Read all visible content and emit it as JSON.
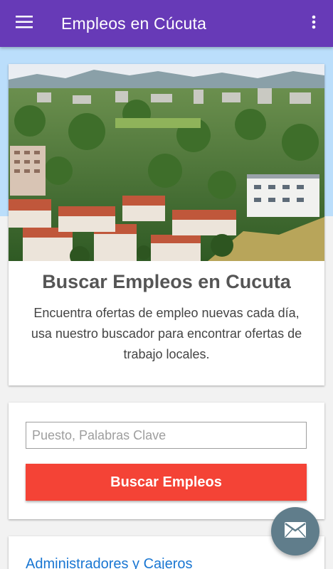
{
  "app_bar": {
    "title": "Empleos en Cúcuta",
    "background": "#673ab7",
    "menu_icon": "hamburger-menu-icon",
    "overflow_icon": "more-vertical-icon"
  },
  "hero": {
    "image_alt": "city-panorama",
    "heading": "Buscar Empleos en Cucuta",
    "text": "Encuentra ofertas de empleo nuevas cada día, usa nuestro buscador para encontrar ofertas de trabajo locales."
  },
  "search": {
    "placeholder": "Puesto, Palabras Clave",
    "value": "",
    "button_label": "Buscar Empleos",
    "button_color": "#f44336"
  },
  "categories": {
    "items": [
      {
        "label": "Administradores y Cajeros"
      }
    ],
    "link_color": "#1976d2"
  },
  "fab": {
    "icon": "mail-icon",
    "color": "#607d8b"
  }
}
